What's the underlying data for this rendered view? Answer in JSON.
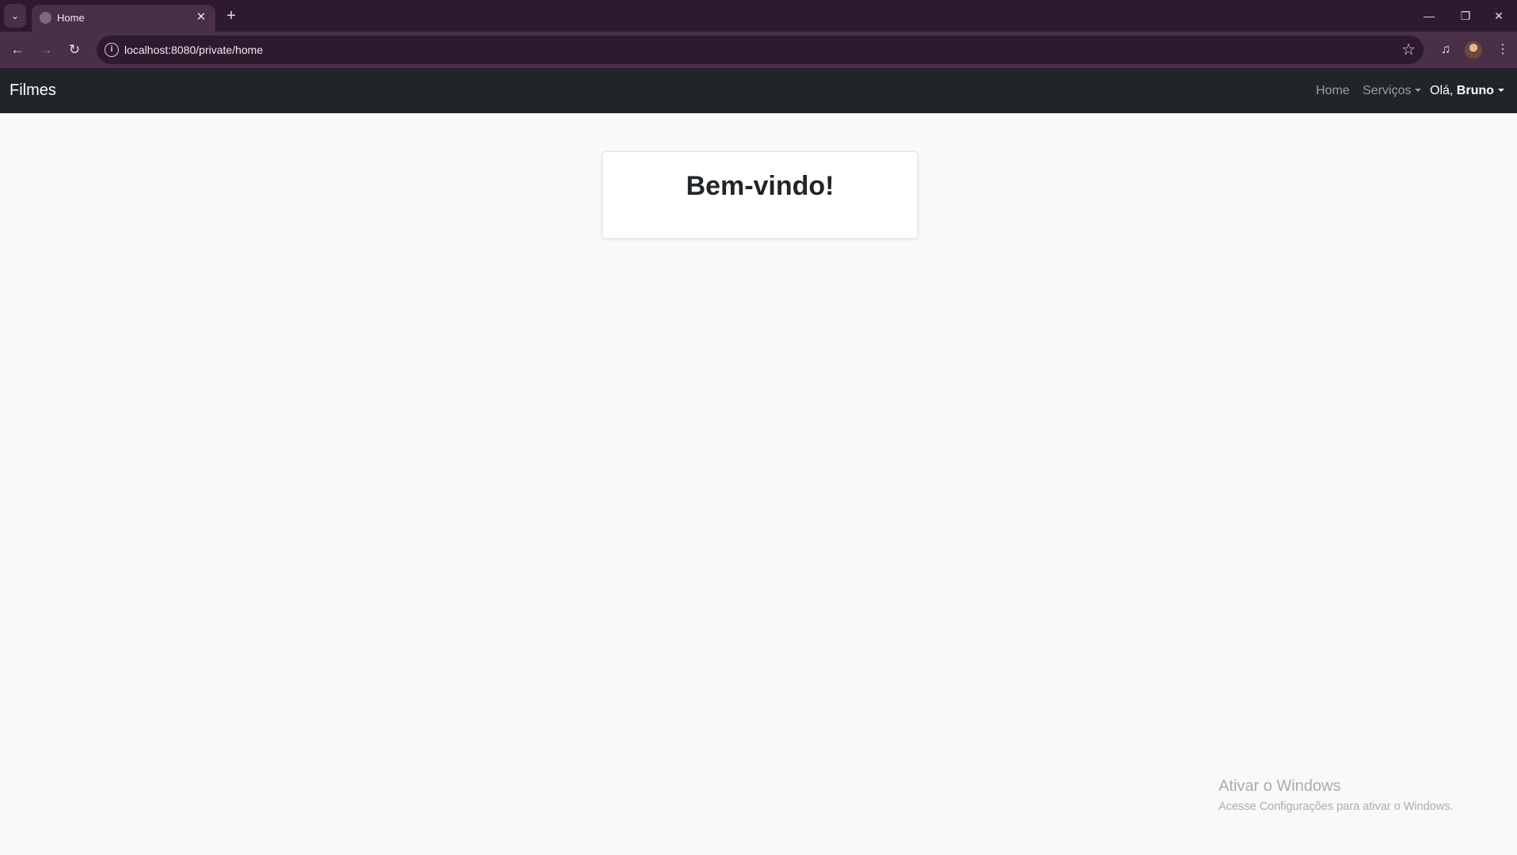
{
  "browser": {
    "tab": {
      "title": "Home"
    },
    "url": "localhost:8080/private/home",
    "icons": {
      "tab_list": "chevron-down-icon",
      "tab_close": "close-icon",
      "new_tab": "plus-icon",
      "back": "back-arrow-icon",
      "forward": "forward-arrow-icon",
      "reload": "reload-icon",
      "site_info": "info-icon",
      "bookmark": "star-icon",
      "media": "media-control-icon",
      "menu": "kebab-menu-icon",
      "minimize": "minimize-icon",
      "restore": "restore-icon",
      "close": "window-close-icon"
    },
    "colors": {
      "frame": "#2e1a2e",
      "toolbar": "#4a2f48"
    }
  },
  "navbar": {
    "brand": "Filmes",
    "items": [
      {
        "label": "Home"
      },
      {
        "label": "Serviços",
        "dropdown": true
      }
    ],
    "user": {
      "greeting": "Olá,",
      "name": "Bruno"
    },
    "colors": {
      "background": "#212529"
    }
  },
  "main": {
    "welcome": "Bem-vindo!"
  },
  "watermark": {
    "title": "Ativar o Windows",
    "subtitle": "Acesse Configurações para ativar o Windows."
  }
}
